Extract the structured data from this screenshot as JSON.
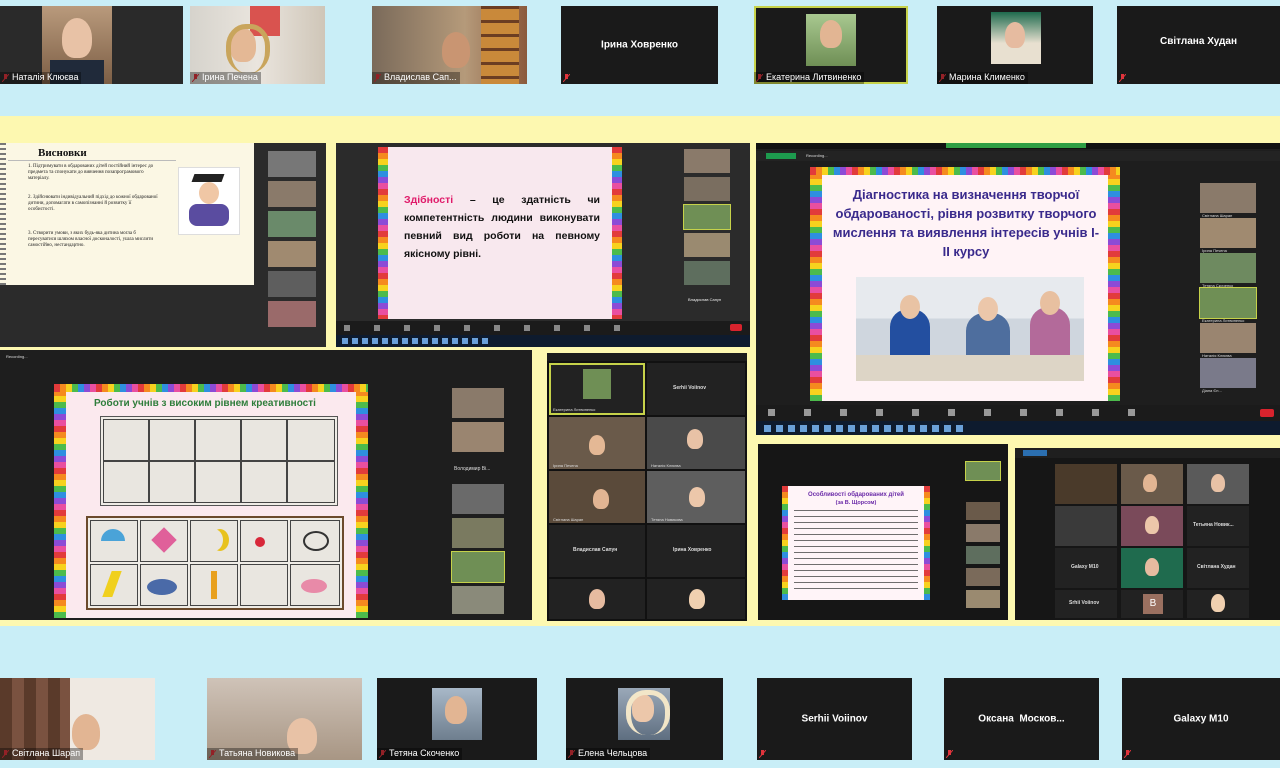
{
  "top_row": [
    {
      "name": "Наталія Клюєва",
      "type": "video"
    },
    {
      "name": "Ірина Печена",
      "type": "video"
    },
    {
      "name": "Владислав Сап...",
      "type": "video"
    },
    {
      "label": "Ірина Ховренко",
      "type": "name-only"
    },
    {
      "name": "Екатерина Литвиненко",
      "type": "video",
      "highlighted": true
    },
    {
      "name": "Марина Клименко",
      "type": "video"
    },
    {
      "label": "Світлана Худан",
      "type": "name-only"
    }
  ],
  "bottom_row": [
    {
      "name": "Світлана Шарап",
      "type": "video"
    },
    {
      "name": "Татьяна Новикова",
      "type": "video"
    },
    {
      "name": "Тетяна Скоченко",
      "type": "video"
    },
    {
      "name": "Елена Чельцова",
      "type": "video"
    },
    {
      "label": "Serhii Voiinov",
      "type": "name-only"
    },
    {
      "label": "Оксана  Москов...",
      "type": "name-only"
    },
    {
      "label": "Galaxy M10",
      "type": "name-only"
    }
  ],
  "shot1": {
    "title": "Висновки",
    "items": [
      "1. Підтримувати в обдарованих дітей постійний інтерес до предмета та спонукати до вивчення позапрограмового матеріалу.",
      "2. Здійснювати індивідуальний підхід до кожної обдарованої дитини, допомагати в самопізнанні й розвитку її особистості.",
      "3. Створити умови, з яких будь-яка дитина могла б пересуватися шляхом власної досконалості, ушла мислити самостійно, нестандартно."
    ]
  },
  "shot2": {
    "term": "Здібності",
    "text": " – це здатність чи компетентність людини виконувати певний вид роботи на певному якісному рівні."
  },
  "shot3": {
    "title": "Діагностика на визначення творчої обдарованості, рівня розвитку творчого мислення та виявлення інтересів учнів І-ІІ курсу",
    "side_names": [
      "Світлана Шарап",
      "Ірина Печена",
      "Тетяна Скоченко",
      "Екатерина Литвиненко",
      "Наталія Клюєва",
      "Марина Клименко",
      "Діана Єн..."
    ],
    "recording": "Recording..."
  },
  "shot4": {
    "title": "Роботи учнів з високим рівнем креативності",
    "recording": "Recording...",
    "side_names": [
      "Світлана Шарап",
      "Наталія Клюєва",
      "Володимир Ві...",
      "Світлана Худан",
      "Оксана Москв...",
      "Екатерина Литвиненко",
      "Тетяна Скоч..."
    ]
  },
  "shot5": {
    "tiles": [
      {
        "label": "Екатерина Литвиненко"
      },
      {
        "label": "Serhii Voiinov"
      },
      {
        "label": "Ірина Печена"
      },
      {
        "label": "Наталія Клюєва"
      },
      {
        "label": "Світлана Шарап"
      },
      {
        "label": "Тетяна Новикова"
      },
      {
        "label": "Владислав Сапун"
      },
      {
        "label": "Ірина Ховренко"
      },
      {
        "label": ""
      },
      {
        "label": ""
      }
    ]
  },
  "shot6": {
    "title": "Особливості обдарованих дітей",
    "subtitle": "(за В. Щорсом)"
  },
  "shot7": {
    "labels": [
      "Тетьяна Новик...",
      "Galaxy M10",
      "Світлана Худан",
      "Srhii Voiinov",
      "B"
    ]
  },
  "colors": {
    "top_band": "#c9eef7",
    "mid_band": "#fdf8b0",
    "bottom_band": "#c9eef7",
    "tile_bg": "#1a1a1a",
    "highlight": "#c6d24a",
    "mic_red": "#e0343c",
    "slide_pink": "#f8e8ee",
    "title_green": "#2e7d3b",
    "title_purple": "#3a2a8c"
  }
}
